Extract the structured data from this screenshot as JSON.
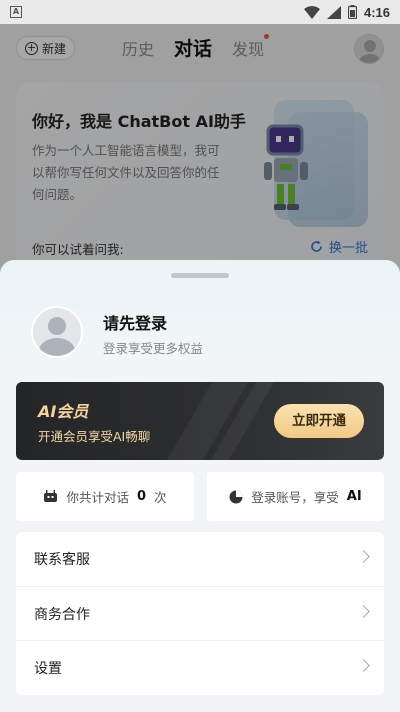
{
  "status_bar": {
    "time": "4:16",
    "app_badge": "A"
  },
  "top_nav": {
    "new_chat": "新建",
    "tabs": [
      {
        "label": "历史",
        "active": false
      },
      {
        "label": "对话",
        "active": true
      },
      {
        "label": "发现",
        "active": false,
        "has_dot": true
      }
    ]
  },
  "welcome": {
    "title": "你好，我是 ChatBot AI助手",
    "description": "作为一个人工智能语言模型，我可以帮你写任何文件以及回答你的任何问题。",
    "try_label": "你可以试着问我:",
    "refresh_label": "换一批"
  },
  "sheet": {
    "login_title": "请先登录",
    "login_subtitle": "登录享受更多权益",
    "vip": {
      "title": "AI会员",
      "subtitle": "开通会员享受AI畅聊",
      "button": "立即开通"
    },
    "stats": {
      "chat_prefix": "你共计对话",
      "chat_count": "0",
      "chat_suffix": "次",
      "login_text": "登录账号，享受",
      "login_em": "AI"
    },
    "menu": [
      {
        "label": "联系客服"
      },
      {
        "label": "商务合作"
      },
      {
        "label": "设置"
      }
    ]
  },
  "colors": {
    "vip_gold": "#f2d49e",
    "accent_blue": "#3a6fd0",
    "notification_dot": "#ee5533"
  }
}
